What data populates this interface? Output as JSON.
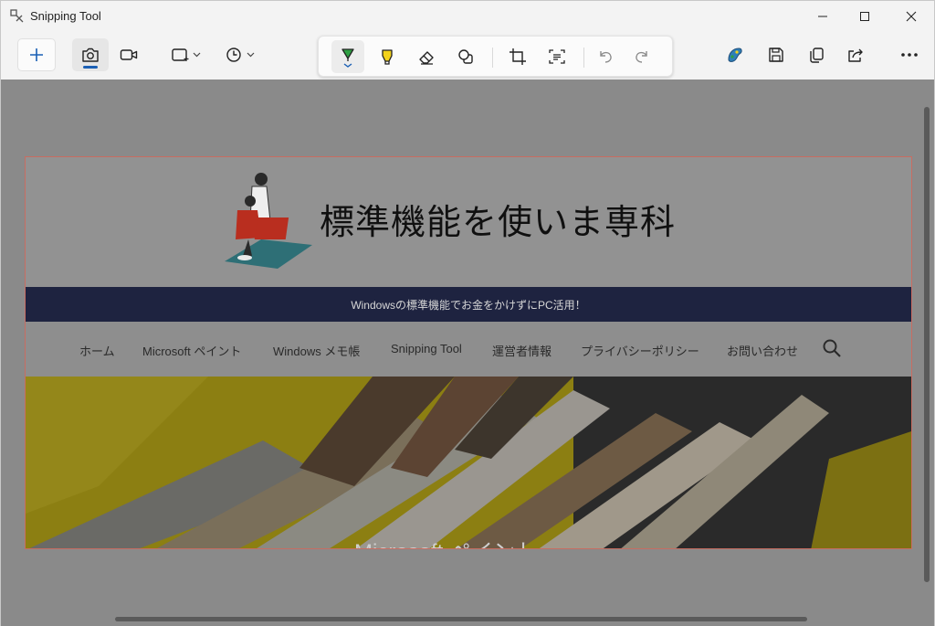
{
  "window": {
    "title": "Snipping Tool"
  },
  "colors": {
    "accent": "#1a5fb4",
    "pen_green": "#2ea043",
    "highlighter_yellow": "#f2d21b",
    "canvas_dim": "#8a8a8a",
    "selection_border": "#c76d62",
    "tagline_bar": "#1e2340"
  },
  "toolbar": {
    "left_tools": [
      {
        "name": "new-snip",
        "icon": "plus-icon"
      },
      {
        "name": "snip-mode-screenshot",
        "icon": "camera-icon",
        "selected": true
      },
      {
        "name": "snip-mode-video",
        "icon": "video-camera-icon"
      },
      {
        "name": "snip-shape",
        "icon": "rectangle-snip-icon"
      },
      {
        "name": "snip-delay",
        "icon": "clock-icon"
      }
    ],
    "markup_tools": [
      {
        "name": "ballpoint-pen",
        "icon": "pen-icon",
        "selected": true
      },
      {
        "name": "highlighter",
        "icon": "highlighter-icon"
      },
      {
        "name": "eraser",
        "icon": "eraser-icon"
      },
      {
        "name": "shapes",
        "icon": "shapes-icon"
      },
      {
        "name": "crop",
        "icon": "crop-icon"
      },
      {
        "name": "text-actions",
        "icon": "text-actions-icon"
      },
      {
        "name": "undo",
        "icon": "undo-icon"
      },
      {
        "name": "redo",
        "icon": "redo-icon"
      }
    ],
    "right_tools": [
      {
        "name": "edit-in-paint",
        "icon": "paint-icon"
      },
      {
        "name": "save",
        "icon": "save-icon"
      },
      {
        "name": "copy",
        "icon": "copy-icon"
      },
      {
        "name": "share",
        "icon": "share-icon"
      },
      {
        "name": "more",
        "icon": "more-icon"
      }
    ]
  },
  "screenshot": {
    "site_title": "標準機能を使いま専科",
    "tagline": "Windowsの標準機能でお金をかけずにPC活用！",
    "nav": [
      "ホーム",
      "Microsoft ペイント",
      "Windows メモ帳",
      "Snipping Tool",
      "運営者情報",
      "プライバシーポリシー",
      "お問い合わせ"
    ],
    "hero_text": "Microsoft ペイント"
  }
}
